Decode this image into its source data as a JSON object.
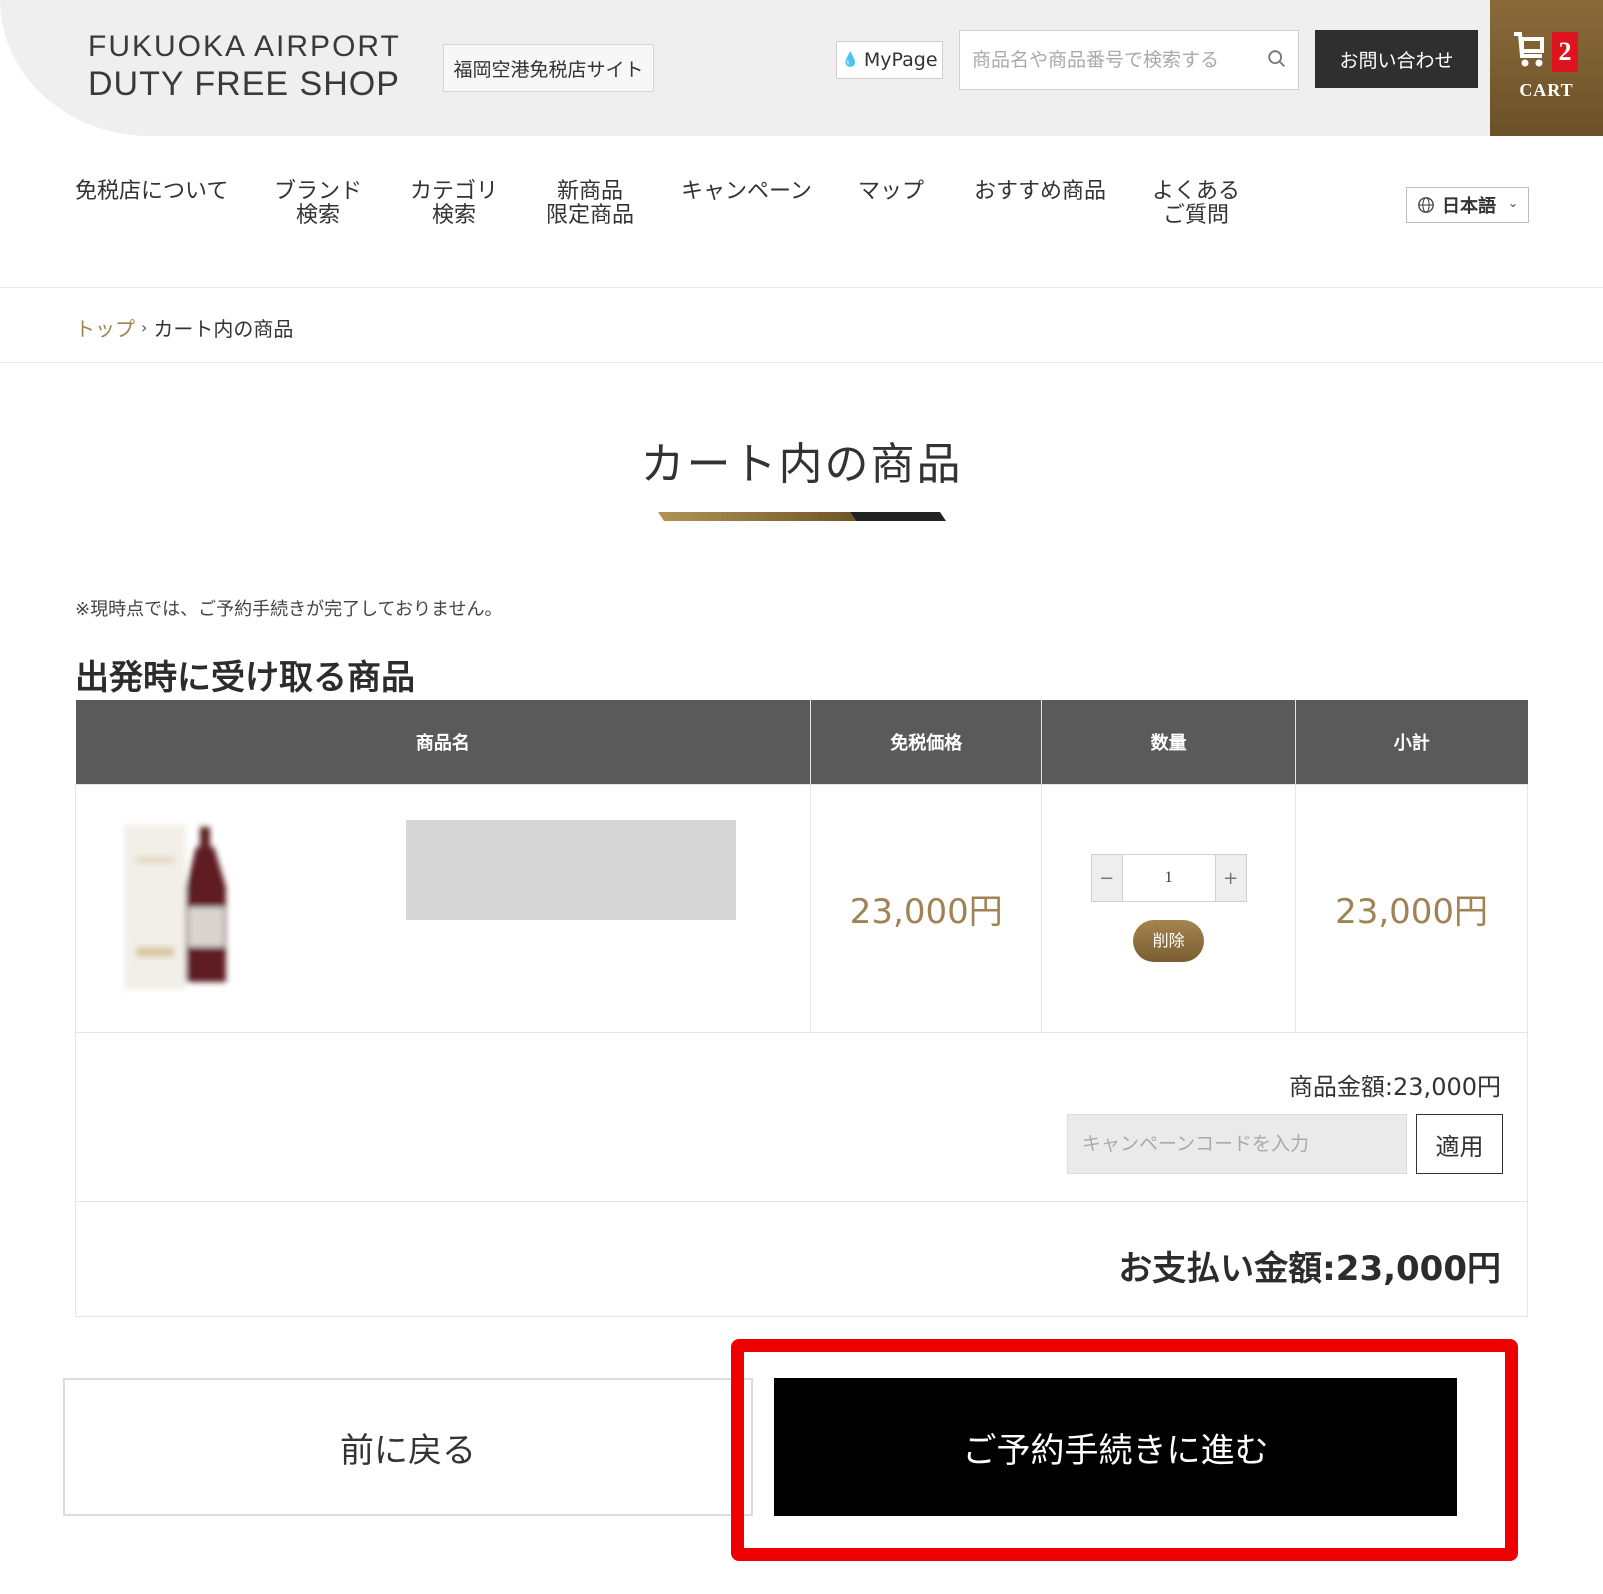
{
  "header": {
    "logo_line1": "FUKUOKA AIRPORT",
    "logo_line2": "DUTY FREE SHOP",
    "site_link": "福岡空港免税店サイト",
    "mypage": "MyPage",
    "search_placeholder": "商品名や商品番号で検索する",
    "contact": "お問い合わせ",
    "cart_count": "2",
    "cart_label": "CART"
  },
  "nav": {
    "items": [
      {
        "line1": "免税店について",
        "line2": ""
      },
      {
        "line1": "ブランド",
        "line2": "検索"
      },
      {
        "line1": "カテゴリ",
        "line2": "検索"
      },
      {
        "line1": "新商品",
        "line2": "限定商品"
      },
      {
        "line1": "キャンペーン",
        "line2": ""
      },
      {
        "line1": "マップ",
        "line2": ""
      },
      {
        "line1": "おすすめ商品",
        "line2": ""
      },
      {
        "line1": "よくある",
        "line2": "ご質問"
      }
    ],
    "language": "日本語"
  },
  "breadcrumb": {
    "home": "トップ",
    "separator": "›",
    "current": "カート内の商品"
  },
  "page": {
    "title": "カート内の商品",
    "notice": "※現時点では、ご予約手続きが完了しておりません。",
    "section_title": "出発時に受け取る商品"
  },
  "table": {
    "headers": [
      "商品名",
      "免税価格",
      "数量",
      "小計"
    ],
    "rows": [
      {
        "price": "23,000円",
        "quantity": "1",
        "subtotal": "23,000円",
        "delete_label": "削除",
        "minus": "−",
        "plus": "+"
      }
    ]
  },
  "summary": {
    "goods_amount": "商品金額:23,000円",
    "coupon_placeholder": "キャンペーンコードを入力",
    "apply_label": "適用",
    "total": "お支払い金額:23,000円"
  },
  "actions": {
    "back": "前に戻る",
    "proceed": "ご予約手続きに進む"
  },
  "colors": {
    "accent_gold": "#a08355",
    "header_bg": "#efefef",
    "table_header": "#5a5a5a",
    "highlight_red": "#ee0000"
  }
}
